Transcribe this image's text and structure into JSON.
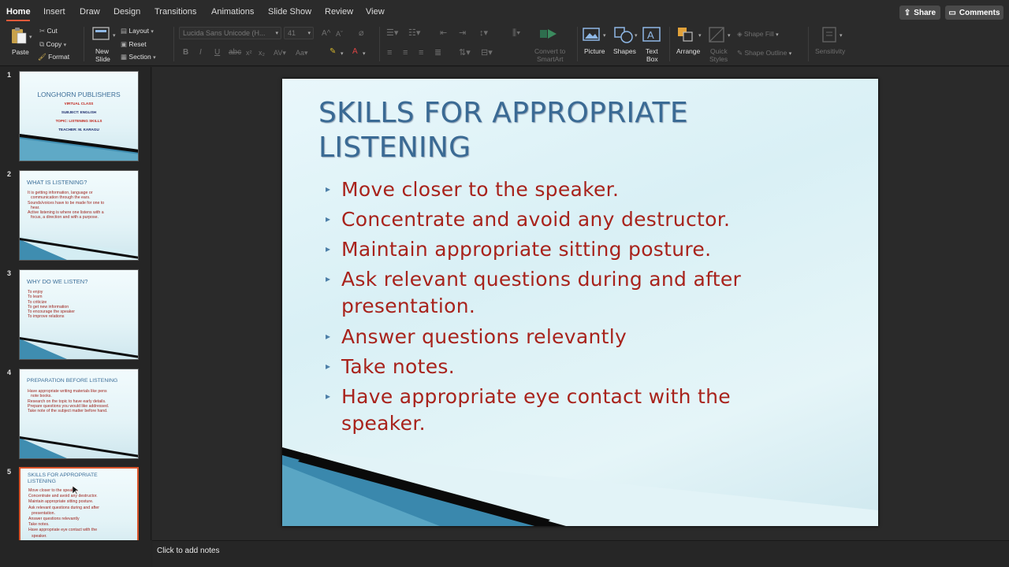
{
  "tabs": [
    "Home",
    "Insert",
    "Draw",
    "Design",
    "Transitions",
    "Animations",
    "Slide Show",
    "Review",
    "View"
  ],
  "active_tab": "Home",
  "top_buttons": {
    "share": "Share",
    "comments": "Comments"
  },
  "ribbon": {
    "paste": "Paste",
    "cut": "Cut",
    "copy": "Copy",
    "format": "Format",
    "new_slide_1": "New",
    "new_slide_2": "Slide",
    "layout": "Layout",
    "reset": "Reset",
    "section": "Section",
    "font_name": "Lucida Sans Unicode (H...",
    "font_size": "41",
    "convert_1": "Convert to",
    "convert_2": "SmartArt",
    "picture": "Picture",
    "shapes": "Shapes",
    "textbox_1": "Text",
    "textbox_2": "Box",
    "arrange": "Arrange",
    "quick_styles_1": "Quick",
    "quick_styles_2": "Styles",
    "shape_fill": "Shape Fill",
    "shape_outline": "Shape Outline",
    "sensitivity": "Sensitivity"
  },
  "thumbnails": [
    {
      "num": "1",
      "title": "LONGHORN PUBLISHERS",
      "lines": [
        "VIRTUAL CLASS",
        "SUBJECT: ENGLISH",
        "TOPIC: LISTENING SKILLS",
        "TEACHER: M. KARAGU"
      ]
    },
    {
      "num": "2",
      "title": "WHAT IS LISTENING?",
      "lines": [
        "It is getting information, language or",
        "communication through the ears.",
        "Sounds/voices have to be made for one to",
        "hear.",
        "Active listening is where one listens with a",
        "focus, a direction and with a purpose."
      ]
    },
    {
      "num": "3",
      "title": "WHY DO WE LISTEN?",
      "lines": [
        "To enjoy",
        "To learn",
        "To criticize",
        "To get new information",
        "To encourage the speaker",
        "To improve relations"
      ]
    },
    {
      "num": "4",
      "title": "PREPARATION BEFORE LISTENING",
      "lines": [
        "Have appropriate writing materials like pens",
        "note books.",
        "Research on the topic to have early details.",
        "Prepare questions you would like addressed.",
        "Take note of the subject matter before hand."
      ]
    },
    {
      "num": "5",
      "title_1": "SKILLS FOR APPROPRIATE",
      "title_2": "LISTENING",
      "lines": [
        "Move closer to the speaker.",
        "Concentrate and avoid any destructor.",
        "Maintain appropriate sitting posture.",
        "Ask relevant questions during and after",
        "presentation.",
        "Answer questions relevantly",
        "Take notes.",
        "Have appropriate eye contact with the",
        "speaker."
      ]
    }
  ],
  "slide": {
    "title_1": "SKILLS FOR APPROPRIATE",
    "title_2": "LISTENING",
    "bullets": [
      [
        "Move closer to the speaker."
      ],
      [
        "Concentrate and avoid any destructor."
      ],
      [
        "Maintain appropriate sitting posture."
      ],
      [
        "Ask relevant questions during and after",
        "presentation."
      ],
      [
        "Answer questions relevantly"
      ],
      [
        "Take notes."
      ],
      [
        "Have appropriate eye contact with the",
        "speaker."
      ]
    ]
  },
  "notes_placeholder": "Click to add notes",
  "colors": {
    "accent": "#d9542b",
    "title_blue": "#3a6a94",
    "bullet_red": "#a8231c"
  }
}
